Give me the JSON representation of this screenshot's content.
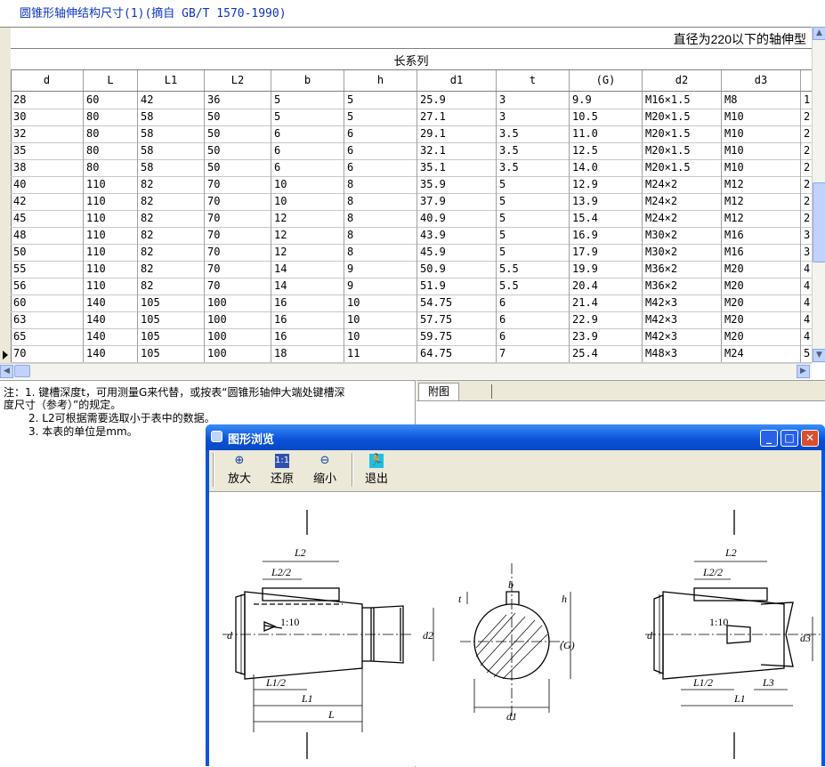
{
  "title": "圆锥形轴伸结构尺寸(1)(摘自 GB/T 1570-1990)",
  "grid": {
    "band1": "直径为220以下的轴伸型",
    "band2": "长系列",
    "columns": [
      "d",
      "L",
      "L1",
      "L2",
      "b",
      "h",
      "d1",
      "t",
      "(G)",
      "d2",
      "d3",
      ""
    ],
    "rows": [
      [
        "28",
        "60",
        "42",
        "36",
        "5",
        "5",
        "25.9",
        "3",
        "9.9",
        "M16×1.5",
        "M8",
        "1"
      ],
      [
        "30",
        "80",
        "58",
        "50",
        "5",
        "5",
        "27.1",
        "3",
        "10.5",
        "M20×1.5",
        "M10",
        "2"
      ],
      [
        "32",
        "80",
        "58",
        "50",
        "6",
        "6",
        "29.1",
        "3.5",
        "11.0",
        "M20×1.5",
        "M10",
        "2"
      ],
      [
        "35",
        "80",
        "58",
        "50",
        "6",
        "6",
        "32.1",
        "3.5",
        "12.5",
        "M20×1.5",
        "M10",
        "2"
      ],
      [
        "38",
        "80",
        "58",
        "50",
        "6",
        "6",
        "35.1",
        "3.5",
        "14.0",
        "M20×1.5",
        "M10",
        "2"
      ],
      [
        "40",
        "110",
        "82",
        "70",
        "10",
        "8",
        "35.9",
        "5",
        "12.9",
        "M24×2",
        "M12",
        "2"
      ],
      [
        "42",
        "110",
        "82",
        "70",
        "10",
        "8",
        "37.9",
        "5",
        "13.9",
        "M24×2",
        "M12",
        "2"
      ],
      [
        "45",
        "110",
        "82",
        "70",
        "12",
        "8",
        "40.9",
        "5",
        "15.4",
        "M24×2",
        "M12",
        "2"
      ],
      [
        "48",
        "110",
        "82",
        "70",
        "12",
        "8",
        "43.9",
        "5",
        "16.9",
        "M30×2",
        "M16",
        "3"
      ],
      [
        "50",
        "110",
        "82",
        "70",
        "12",
        "8",
        "45.9",
        "5",
        "17.9",
        "M30×2",
        "M16",
        "3"
      ],
      [
        "55",
        "110",
        "82",
        "70",
        "14",
        "9",
        "50.9",
        "5.5",
        "19.9",
        "M36×2",
        "M20",
        "4"
      ],
      [
        "56",
        "110",
        "82",
        "70",
        "14",
        "9",
        "51.9",
        "5.5",
        "20.4",
        "M36×2",
        "M20",
        "4"
      ],
      [
        "60",
        "140",
        "105",
        "100",
        "16",
        "10",
        "54.75",
        "6",
        "21.4",
        "M42×3",
        "M20",
        "4"
      ],
      [
        "63",
        "140",
        "105",
        "100",
        "16",
        "10",
        "57.75",
        "6",
        "22.9",
        "M42×3",
        "M20",
        "4"
      ],
      [
        "65",
        "140",
        "105",
        "100",
        "16",
        "10",
        "59.75",
        "6",
        "23.9",
        "M42×3",
        "M20",
        "4"
      ],
      [
        "70",
        "140",
        "105",
        "100",
        "18",
        "11",
        "64.75",
        "7",
        "25.4",
        "M48×3",
        "M24",
        "5"
      ]
    ]
  },
  "notes": {
    "line1": "注：1. 键槽深度t，可用测量G来代替，或按表“圆锥形轴伸大端处键槽深",
    "line2": "度尺寸（参考）”的规定。",
    "line3": "2. L2可根据需要选取小于表中的数据。",
    "line4": "3. 本表的单位是mm。"
  },
  "tabs": {
    "tab1": "附图",
    "tab2": ""
  },
  "preview": {
    "title": "图形浏览",
    "min": "_",
    "max": "□",
    "close": "✕",
    "toolbar": {
      "zoom_in": "放大",
      "restore": "还原",
      "zoom_out": "缩小",
      "exit": "退出"
    },
    "labels": {
      "L2": "L2",
      "L2half": "L2/2",
      "taper": "1:10",
      "d": "d",
      "d2": "d2",
      "L1half": "L1/2",
      "L1": "L1",
      "L": "L",
      "b": "b",
      "t": "t",
      "h": "h",
      "G": "(G)",
      "d1": "d1",
      "L3": "L3",
      "d3": "d3"
    }
  }
}
